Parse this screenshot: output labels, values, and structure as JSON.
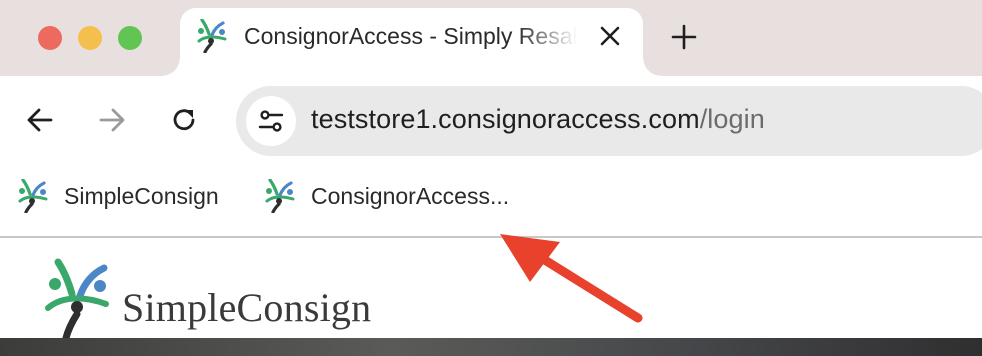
{
  "window": {
    "controls": [
      "close",
      "minimize",
      "maximize"
    ]
  },
  "tab": {
    "title": "ConsignorAccess - Simply Resale",
    "favicon": "simpleconsign-logo-icon",
    "close_icon": "close-icon"
  },
  "new_tab_icon": "plus-icon",
  "toolbar": {
    "back_icon": "arrow-left-icon",
    "forward_icon": "arrow-right-icon",
    "reload_icon": "reload-icon",
    "site_info_icon": "tune-icon",
    "url_host": "teststore1.consignoraccess.com",
    "url_path": "/login"
  },
  "bookmarks": [
    {
      "label": "SimpleConsign",
      "icon": "simpleconsign-logo-icon"
    },
    {
      "label": "ConsignorAccess...",
      "icon": "simpleconsign-logo-icon"
    }
  ],
  "page": {
    "logo_text": "SimpleConsign"
  },
  "annotation": {
    "arrow_color": "#e8412c",
    "points_to": "bookmark ConsignorAccess..."
  },
  "colors": {
    "tabstrip": "#e8e0de",
    "logo_green": "#3aa86b",
    "logo_blue": "#4a86c8",
    "logo_dark": "#2f2f2f"
  }
}
